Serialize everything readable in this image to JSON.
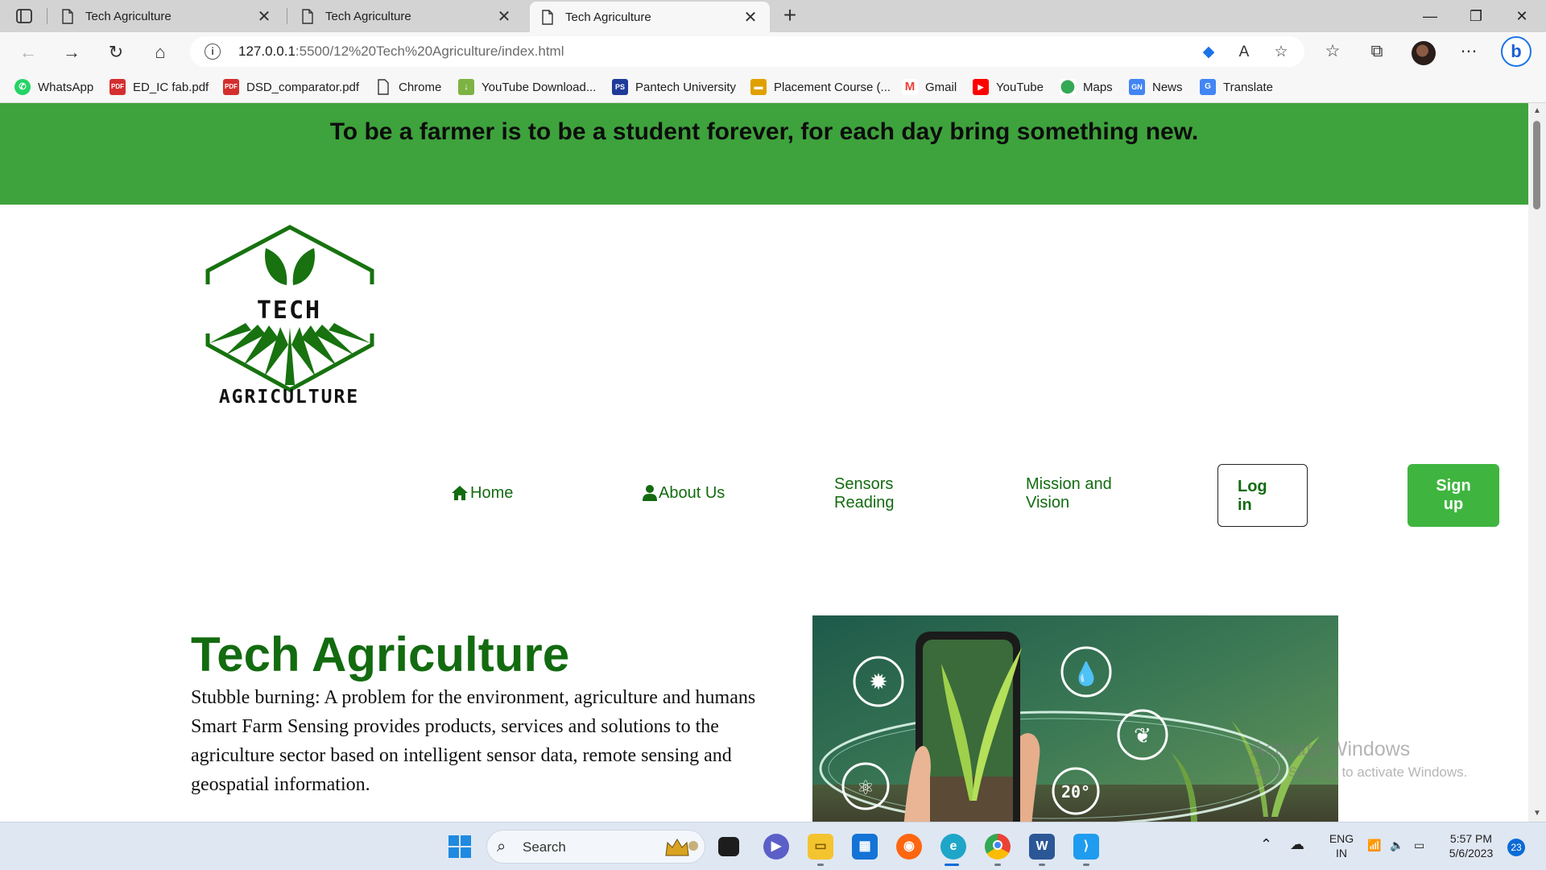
{
  "browser": {
    "tabs": [
      {
        "title": "Tech Agriculture"
      },
      {
        "title": "Tech Agriculture"
      },
      {
        "title": "Tech Agriculture"
      }
    ],
    "url_host": "127.0.0.1",
    "url_path": ":5500/12%20Tech%20Agriculture/index.html",
    "bookmarks": [
      {
        "label": "WhatsApp",
        "icon": "whatsapp-icon",
        "color": "#25d366"
      },
      {
        "label": "ED_IC fab.pdf",
        "icon": "pdf-icon",
        "color": "#d32f2f"
      },
      {
        "label": "DSD_comparator.pdf",
        "icon": "pdf-icon",
        "color": "#d32f2f"
      },
      {
        "label": "Chrome",
        "icon": "page-icon",
        "color": "#ffffff"
      },
      {
        "label": "YouTube Download...",
        "icon": "download-icon",
        "color": "#7cb342"
      },
      {
        "label": "Pantech University",
        "icon": "pantech-icon",
        "color": "#1f3b99"
      },
      {
        "label": "Placement Course (...",
        "icon": "course-icon",
        "color": "#e0a100"
      },
      {
        "label": "Gmail",
        "icon": "gmail-icon",
        "color": "#ea4335"
      },
      {
        "label": "YouTube",
        "icon": "youtube-icon",
        "color": "#ff0000"
      },
      {
        "label": "Maps",
        "icon": "maps-icon",
        "color": "#34a853"
      },
      {
        "label": "News",
        "icon": "news-icon",
        "color": "#4285f4"
      },
      {
        "label": "Translate",
        "icon": "translate-icon",
        "color": "#4285f4"
      }
    ]
  },
  "page": {
    "quote": "To be a farmer is to be a student forever, for each day bring something new.",
    "logo": {
      "line1": "TECH",
      "line2": "AGRICULTURE"
    },
    "nav": {
      "home": "Home",
      "about": "About Us",
      "sensors": "Sensors Reading",
      "mission": "Mission and Vision",
      "login": "Log in",
      "signup": "Sign up"
    },
    "hero": {
      "title": "Tech Agriculture",
      "para1": "Stubble burning: A problem for the environment, agriculture and humans",
      "para2": "Smart Farm Sensing provides products, services and solutions to the agriculture sector based on intelligent sensor data, remote sensing and geospatial information.",
      "image_temp_label": "20°"
    },
    "watermark": {
      "line1": "Activate Windows",
      "line2": "Go to Settings to activate Windows."
    }
  },
  "colors": {
    "banner": "#3ea33c",
    "brand_green": "#136b10",
    "signup_green": "#3fb53f"
  },
  "taskbar": {
    "search_placeholder": "Search",
    "lang": "ENG",
    "region": "IN",
    "time": "5:57 PM",
    "date": "5/6/2023",
    "notification_count": "23"
  }
}
